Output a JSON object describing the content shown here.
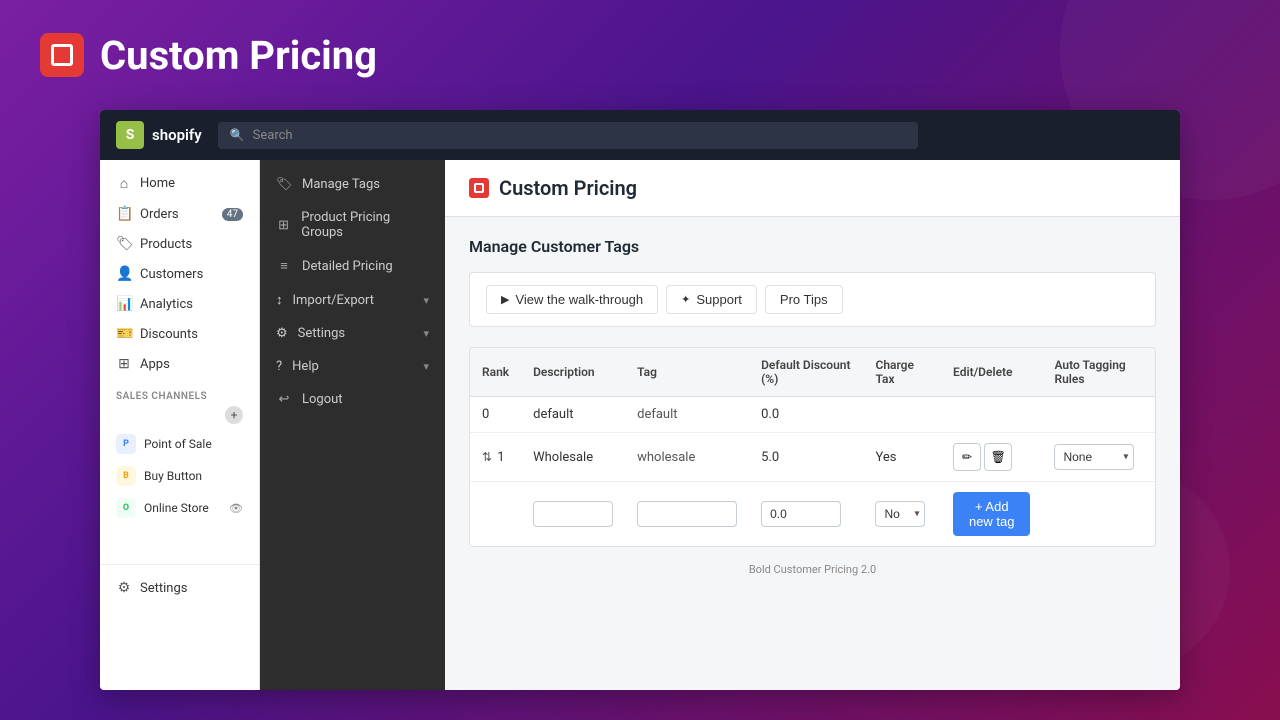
{
  "app": {
    "title": "Custom Pricing",
    "icon_alt": "Custom Pricing app icon"
  },
  "topnav": {
    "shopify_label": "shopify",
    "search_placeholder": "Search"
  },
  "sidebar": {
    "items": [
      {
        "id": "home",
        "label": "Home",
        "icon": "🏠"
      },
      {
        "id": "orders",
        "label": "Orders",
        "icon": "📋",
        "badge": "47"
      },
      {
        "id": "products",
        "label": "Products",
        "icon": "🏷️"
      },
      {
        "id": "customers",
        "label": "Customers",
        "icon": "👤"
      },
      {
        "id": "analytics",
        "label": "Analytics",
        "icon": "📊"
      },
      {
        "id": "discounts",
        "label": "Discounts",
        "icon": "🎫"
      },
      {
        "id": "apps",
        "label": "Apps",
        "icon": "⊞"
      }
    ],
    "sales_channels_title": "SALES CHANNELS",
    "channels": [
      {
        "id": "point-of-sale",
        "label": "Point of Sale",
        "color": "#4a90e2"
      },
      {
        "id": "buy-button",
        "label": "Buy Button",
        "color": "#f5a623"
      },
      {
        "id": "online-store",
        "label": "Online Store",
        "color": "#7ed321"
      }
    ],
    "settings_label": "Settings"
  },
  "submenu": {
    "items": [
      {
        "id": "manage-tags",
        "label": "Manage Tags",
        "icon": "🏷",
        "has_arrow": false
      },
      {
        "id": "product-pricing-groups",
        "label": "Product Pricing Groups",
        "icon": "⊞",
        "has_arrow": false
      },
      {
        "id": "detailed-pricing",
        "label": "Detailed Pricing",
        "icon": "≡",
        "has_arrow": false
      },
      {
        "id": "import-export",
        "label": "Import/Export",
        "icon": "↕",
        "has_arrow": true
      },
      {
        "id": "settings",
        "label": "Settings",
        "icon": "⚙",
        "has_arrow": true
      },
      {
        "id": "help",
        "label": "Help",
        "icon": "?",
        "has_arrow": true
      },
      {
        "id": "logout",
        "label": "Logout",
        "icon": "↩",
        "has_arrow": false
      }
    ]
  },
  "page": {
    "title": "Custom Pricing",
    "section_title": "Manage Customer Tags"
  },
  "action_buttons": [
    {
      "id": "walkthrough",
      "label": "View the walk-through",
      "icon": "▶"
    },
    {
      "id": "support",
      "label": "Support",
      "icon": "✦"
    },
    {
      "id": "pro-tips",
      "label": "Pro Tips"
    }
  ],
  "table": {
    "headers": [
      "Rank",
      "Description",
      "Tag",
      "Default Discount (%)",
      "Charge Tax",
      "Edit/Delete",
      "Auto Tagging Rules"
    ],
    "rows": [
      {
        "rank": "0",
        "description": "default",
        "tag": "default",
        "default_discount": "0.0",
        "charge_tax": "",
        "edit": false,
        "delete": false,
        "auto_tagging": ""
      },
      {
        "rank": "⇅ 1",
        "description": "Wholesale",
        "tag": "wholesale",
        "default_discount": "5.0",
        "charge_tax": "Yes",
        "edit": true,
        "delete": true,
        "auto_tagging": "None"
      }
    ],
    "new_row": {
      "rank": "",
      "description_placeholder": "",
      "tag_placeholder": "",
      "default_discount": "0.0",
      "charge_tax": "No",
      "button_label": "+ Add new tag"
    }
  },
  "footer": {
    "text": "Bold Customer Pricing 2.0"
  }
}
